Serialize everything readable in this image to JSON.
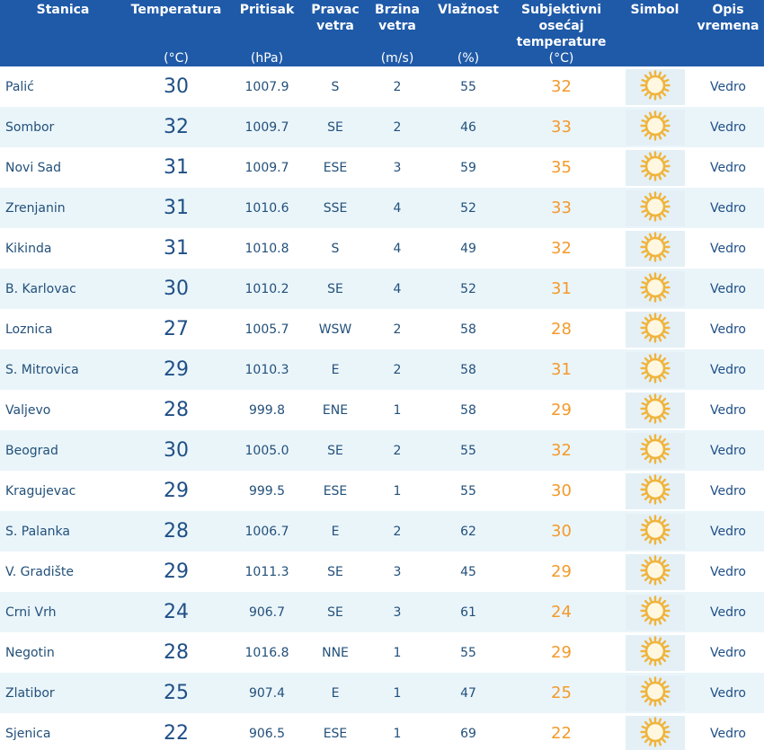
{
  "header": {
    "station": "Stanica",
    "temperature": "Temperatura",
    "temperature_unit": "(°C)",
    "pressure": "Pritisak",
    "pressure_unit": "(hPa)",
    "wind_dir_1": "Pravac",
    "wind_dir_2": "vetra",
    "wind_speed_1": "Brzina",
    "wind_speed_2": "vetra",
    "wind_speed_unit": "(m/s)",
    "humidity": "Vlažnost",
    "humidity_unit": "(%)",
    "feels_1": "Subjektivni",
    "feels_2": "osećaj",
    "feels_3": "temperature",
    "feels_unit": "(°C)",
    "symbol": "Simbol",
    "desc_1": "Opis",
    "desc_2": "vremena"
  },
  "colors": {
    "header_bg": "#1f5aa8",
    "row_alt_bg": "#eaf5fa",
    "temp_text": "#1f4f86",
    "feels_text": "#f39a2b",
    "sun_icon": "#f0b43c"
  },
  "rows": [
    {
      "station": "Palić",
      "temp": "30",
      "pressure": "1007.9",
      "wind_dir": "S",
      "wind_speed": "2",
      "humidity": "55",
      "feels": "32",
      "icon": "sun-icon",
      "desc": "Vedro"
    },
    {
      "station": "Sombor",
      "temp": "32",
      "pressure": "1009.7",
      "wind_dir": "SE",
      "wind_speed": "2",
      "humidity": "46",
      "feels": "33",
      "icon": "sun-icon",
      "desc": "Vedro"
    },
    {
      "station": "Novi Sad",
      "temp": "31",
      "pressure": "1009.7",
      "wind_dir": "ESE",
      "wind_speed": "3",
      "humidity": "59",
      "feels": "35",
      "icon": "sun-icon",
      "desc": "Vedro"
    },
    {
      "station": "Zrenjanin",
      "temp": "31",
      "pressure": "1010.6",
      "wind_dir": "SSE",
      "wind_speed": "4",
      "humidity": "52",
      "feels": "33",
      "icon": "sun-icon",
      "desc": "Vedro"
    },
    {
      "station": "Kikinda",
      "temp": "31",
      "pressure": "1010.8",
      "wind_dir": "S",
      "wind_speed": "4",
      "humidity": "49",
      "feels": "32",
      "icon": "sun-icon",
      "desc": "Vedro"
    },
    {
      "station": "B. Karlovac",
      "temp": "30",
      "pressure": "1010.2",
      "wind_dir": "SE",
      "wind_speed": "4",
      "humidity": "52",
      "feels": "31",
      "icon": "sun-icon",
      "desc": "Vedro"
    },
    {
      "station": "Loznica",
      "temp": "27",
      "pressure": "1005.7",
      "wind_dir": "WSW",
      "wind_speed": "2",
      "humidity": "58",
      "feels": "28",
      "icon": "sun-icon",
      "desc": "Vedro"
    },
    {
      "station": "S. Mitrovica",
      "temp": "29",
      "pressure": "1010.3",
      "wind_dir": "E",
      "wind_speed": "2",
      "humidity": "58",
      "feels": "31",
      "icon": "sun-icon",
      "desc": "Vedro"
    },
    {
      "station": "Valjevo",
      "temp": "28",
      "pressure": "999.8",
      "wind_dir": "ENE",
      "wind_speed": "1",
      "humidity": "58",
      "feels": "29",
      "icon": "sun-icon",
      "desc": "Vedro"
    },
    {
      "station": "Beograd",
      "temp": "30",
      "pressure": "1005.0",
      "wind_dir": "SE",
      "wind_speed": "2",
      "humidity": "55",
      "feels": "32",
      "icon": "sun-icon",
      "desc": "Vedro"
    },
    {
      "station": "Kragujevac",
      "temp": "29",
      "pressure": "999.5",
      "wind_dir": "ESE",
      "wind_speed": "1",
      "humidity": "55",
      "feels": "30",
      "icon": "sun-icon",
      "desc": "Vedro"
    },
    {
      "station": "S. Palanka",
      "temp": "28",
      "pressure": "1006.7",
      "wind_dir": "E",
      "wind_speed": "2",
      "humidity": "62",
      "feels": "30",
      "icon": "sun-icon",
      "desc": "Vedro"
    },
    {
      "station": "V. Gradište",
      "temp": "29",
      "pressure": "1011.3",
      "wind_dir": "SE",
      "wind_speed": "3",
      "humidity": "45",
      "feels": "29",
      "icon": "sun-icon",
      "desc": "Vedro"
    },
    {
      "station": "Crni Vrh",
      "temp": "24",
      "pressure": "906.7",
      "wind_dir": "SE",
      "wind_speed": "3",
      "humidity": "61",
      "feels": "24",
      "icon": "sun-icon",
      "desc": "Vedro"
    },
    {
      "station": "Negotin",
      "temp": "28",
      "pressure": "1016.8",
      "wind_dir": "NNE",
      "wind_speed": "1",
      "humidity": "55",
      "feels": "29",
      "icon": "sun-icon",
      "desc": "Vedro"
    },
    {
      "station": "Zlatibor",
      "temp": "25",
      "pressure": "907.4",
      "wind_dir": "E",
      "wind_speed": "1",
      "humidity": "47",
      "feels": "25",
      "icon": "sun-icon",
      "desc": "Vedro"
    },
    {
      "station": "Sjenica",
      "temp": "22",
      "pressure": "906.5",
      "wind_dir": "ESE",
      "wind_speed": "1",
      "humidity": "69",
      "feels": "22",
      "icon": "sun-icon",
      "desc": "Vedro"
    }
  ]
}
